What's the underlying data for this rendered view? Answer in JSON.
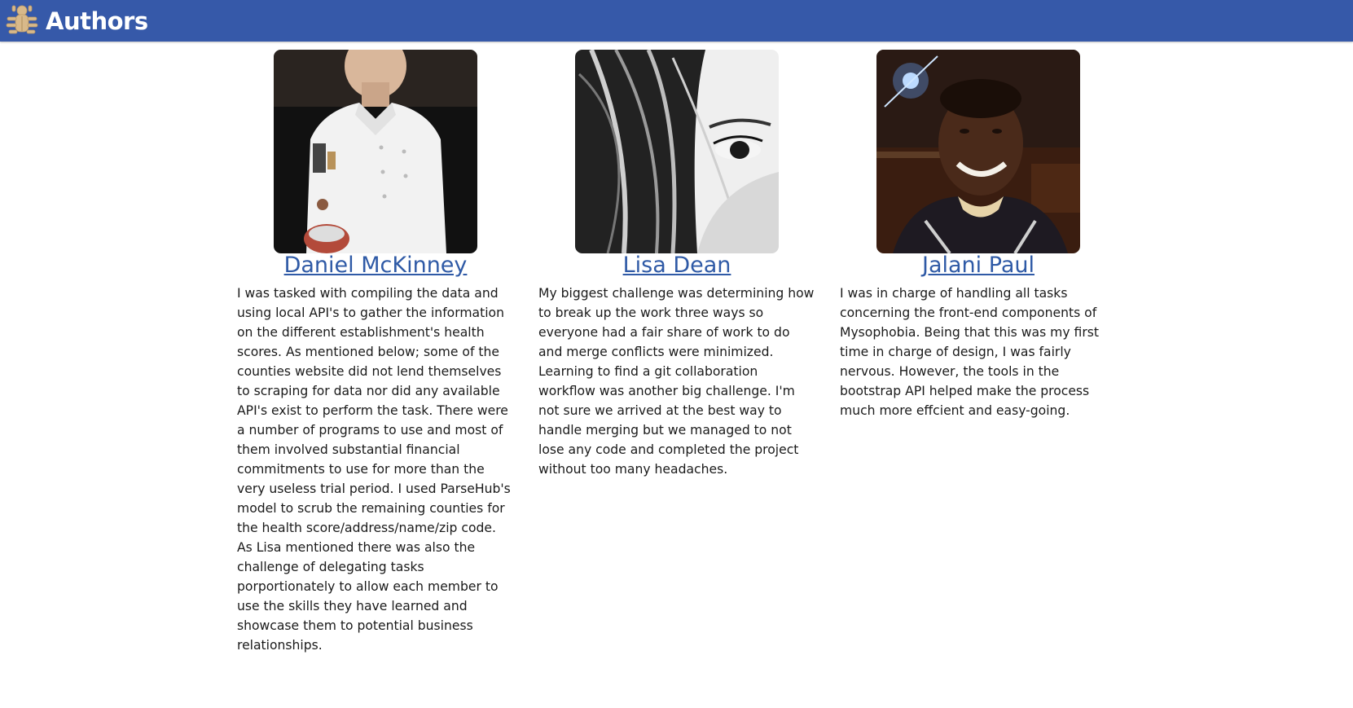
{
  "header": {
    "title": "Authors",
    "logo_icon": "bug-logo-icon",
    "background": "#3659a9"
  },
  "authors": [
    {
      "name": "Daniel McKinney",
      "photo": "chef-portrait",
      "bio": "I was tasked with compiling the data and using local API's to gather the information on the different establishment's health scores. As mentioned below; some of the counties website did not lend themselves to scraping for data nor did any available API's exist to perform the task. There were a number of programs to use and most of them involved substantial financial commitments to use for more than the very useless trial period. I used ParseHub's model to scrub the remaining counties for the health score/address/name/zip code. As Lisa mentioned there was also the challenge of delegating tasks porportionately to allow each member to use the skills they have learned and showcase them to potential business relationships."
    },
    {
      "name": "Lisa Dean",
      "photo": "black-white-eye-portrait",
      "bio": "My biggest challenge was determining how to break up the work three ways so everyone had a fair share of work to do and merge conflicts were minimized. Learning to find a git collaboration workflow was another big challenge. I'm not sure we arrived at the best way to handle merging but we managed to not lose any code and completed the project without too many headaches."
    },
    {
      "name": "Jalani Paul",
      "photo": "night-selfie-portrait",
      "bio": "I was in charge of handling all tasks concerning the front-end components of Mysophobia. Being that this was my first time in charge of design, I was fairly nervous. However, the tools in the bootstrap API helped make the process much more effcient and easy-going."
    }
  ]
}
